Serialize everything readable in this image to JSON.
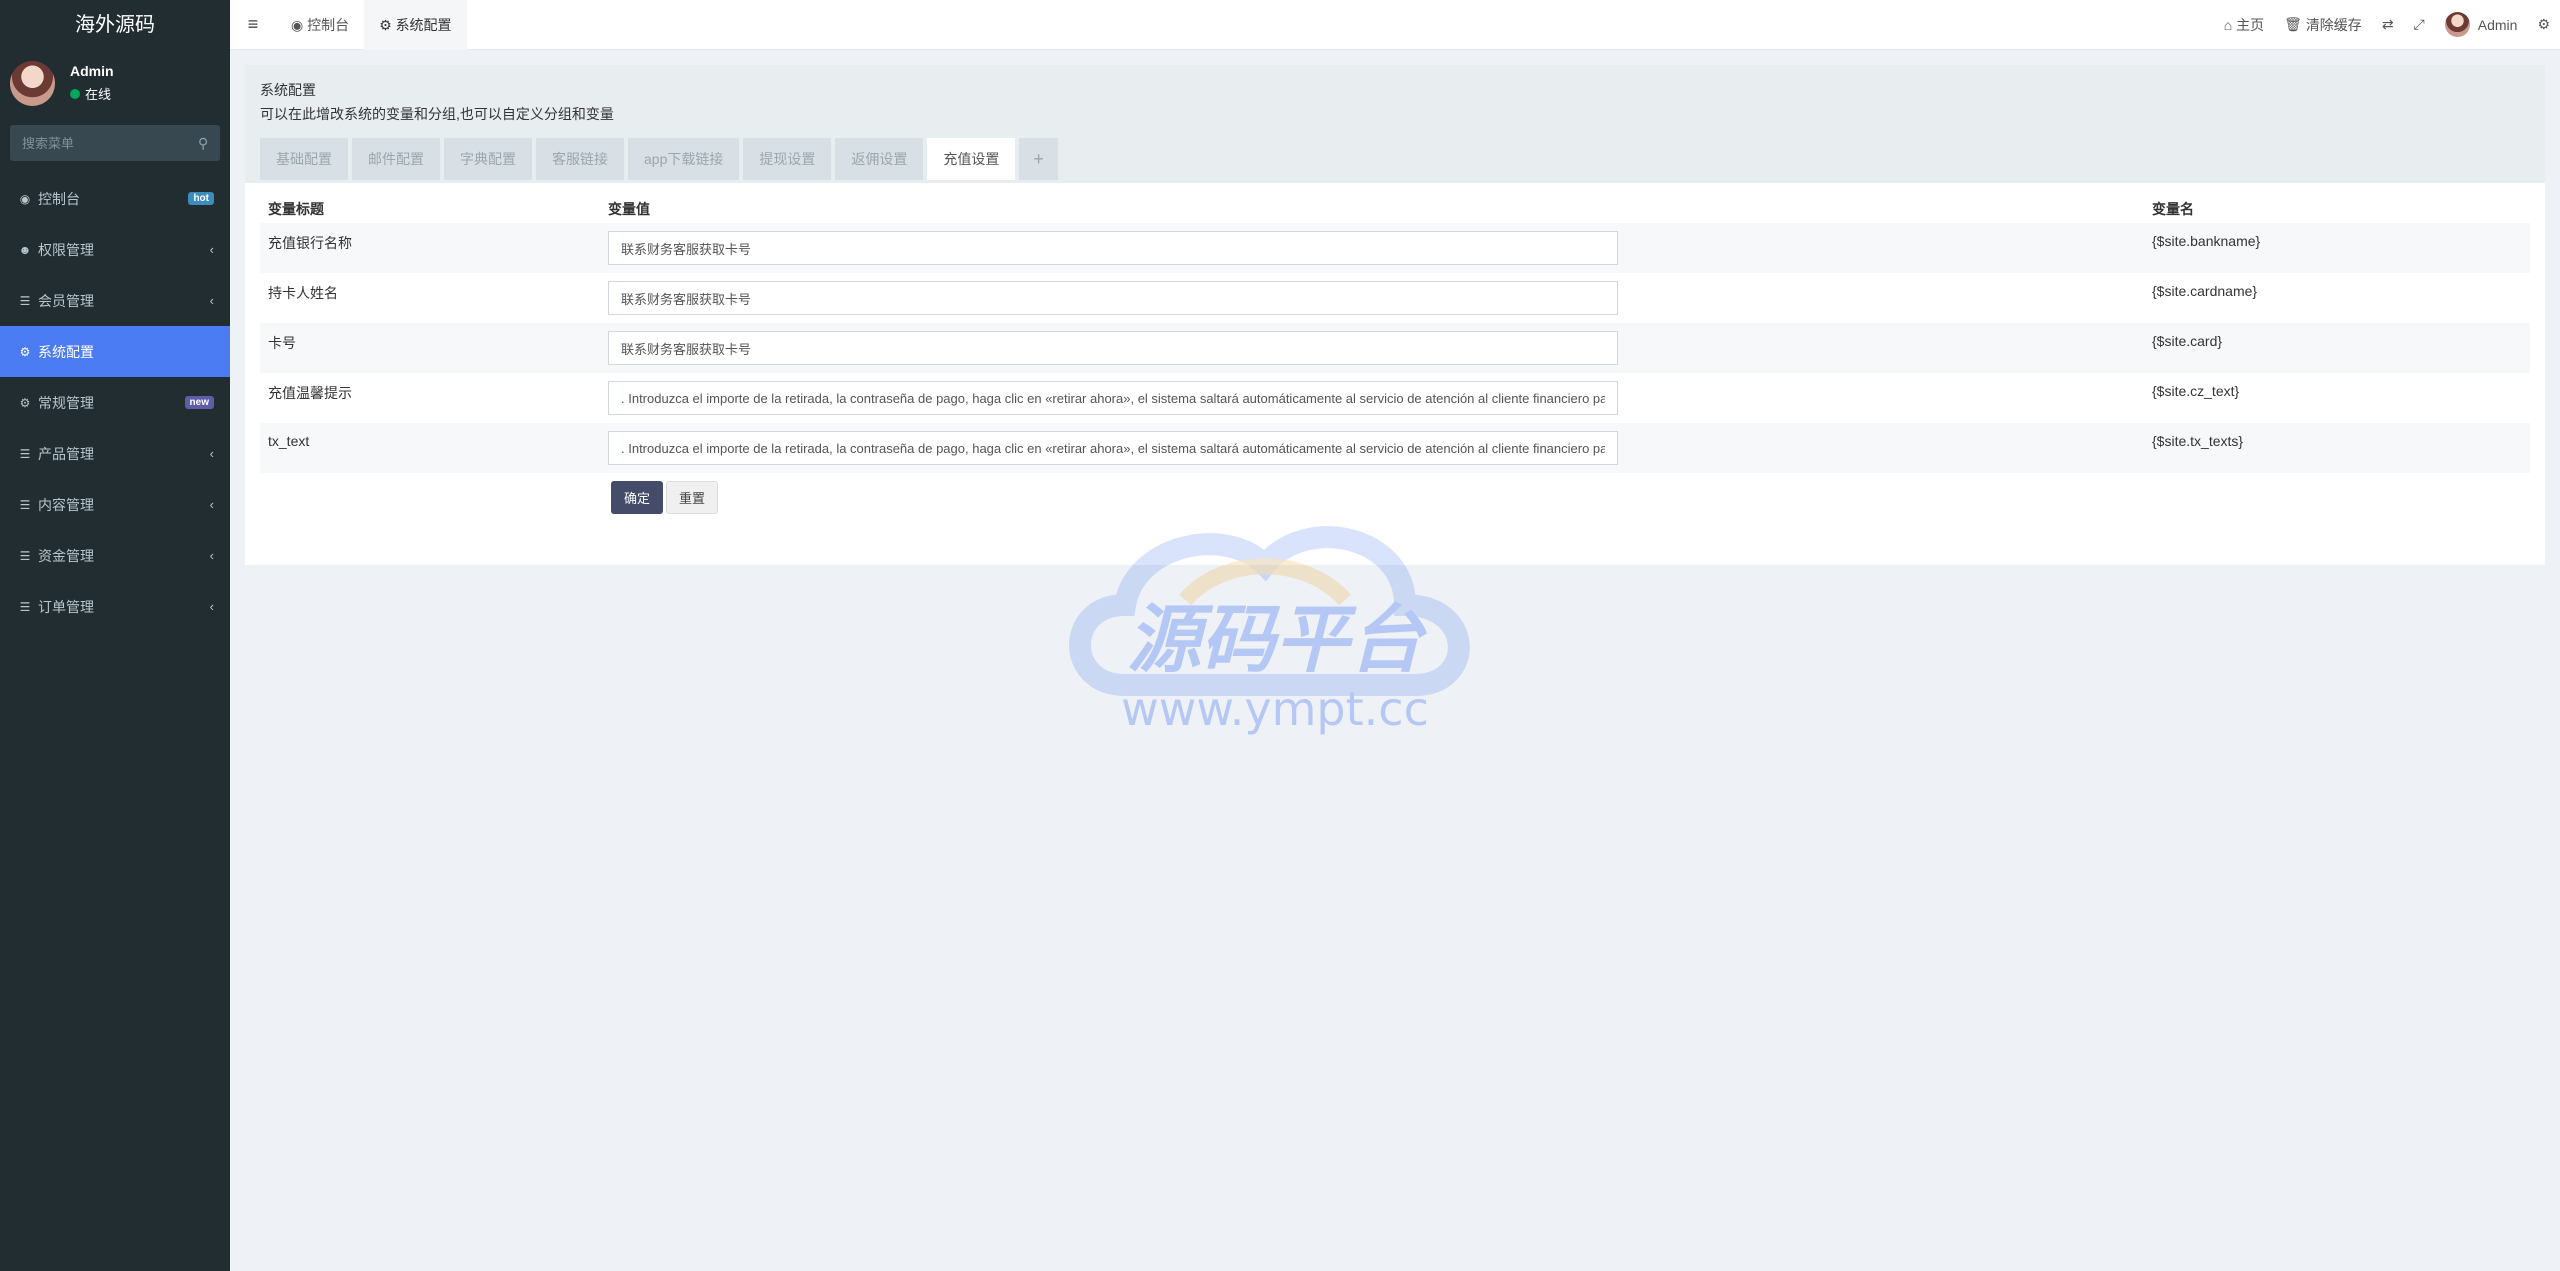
{
  "brand": "海外源码",
  "user": {
    "name": "Admin",
    "status": "在线"
  },
  "search": {
    "placeholder": "搜索菜单"
  },
  "menu": [
    {
      "label": "控制台",
      "icon": "dashboard-icon",
      "badge": "hot"
    },
    {
      "label": "权限管理",
      "icon": "users-icon",
      "chevron": "‹"
    },
    {
      "label": "会员管理",
      "icon": "list-icon",
      "chevron": "‹"
    },
    {
      "label": "系统配置",
      "icon": "gear-icon",
      "active": true
    },
    {
      "label": "常规管理",
      "icon": "cogs-icon",
      "badge": "new"
    },
    {
      "label": "产品管理",
      "icon": "list-icon",
      "chevron": "‹"
    },
    {
      "label": "内容管理",
      "icon": "list-icon",
      "chevron": "‹"
    },
    {
      "label": "资金管理",
      "icon": "list-icon",
      "chevron": "‹"
    },
    {
      "label": "订单管理",
      "icon": "list-icon",
      "chevron": "‹"
    }
  ],
  "topbar": {
    "tabs": [
      {
        "label": "控制台",
        "icon": "dashboard-icon"
      },
      {
        "label": "系统配置",
        "icon": "gear-icon"
      }
    ],
    "home": "主页",
    "clear_cache": "清除缓存",
    "admin": "Admin"
  },
  "panel": {
    "title": "系统配置",
    "description": "可以在此增改系统的变量和分组,也可以自定义分组和变量",
    "tabs": [
      "基础配置",
      "邮件配置",
      "字典配置",
      "客服链接",
      "app下载链接",
      "提现设置",
      "返佣设置",
      "充值设置",
      "+"
    ],
    "active_tab": "充值设置"
  },
  "table": {
    "headers": [
      "变量标题",
      "变量值",
      "变量名"
    ],
    "rows": [
      {
        "title": "充值银行名称",
        "value": "联系财务客服获取卡号",
        "var": "{$site.bankname}"
      },
      {
        "title": "持卡人姓名",
        "value": "联系财务客服获取卡号",
        "var": "{$site.cardname}"
      },
      {
        "title": "卡号",
        "value": "联系财务客服获取卡号",
        "var": "{$site.card}"
      },
      {
        "title": "充值温馨提示",
        "value": ". Introduzca el importe de la retirada, la contraseña de pago, haga clic en «retirar ahora», el sistema saltará automáticamente al servicio de atención al cliente financiero pa",
        "var": "{$site.cz_text}"
      },
      {
        "title": "tx_text",
        "value": ". Introduzca el importe de la retirada, la contraseña de pago, haga clic en «retirar ahora», el sistema saltará automáticamente al servicio de atención al cliente financiero pa",
        "var": "{$site.tx_texts}"
      }
    ]
  },
  "buttons": {
    "submit": "确定",
    "reset": "重置"
  },
  "watermark": {
    "text": "源码平台",
    "url": "www.ympt.cc"
  },
  "colors": {
    "sidebar": "#222d32",
    "active": "#4c7cf3",
    "primary_button": "#444c69"
  }
}
